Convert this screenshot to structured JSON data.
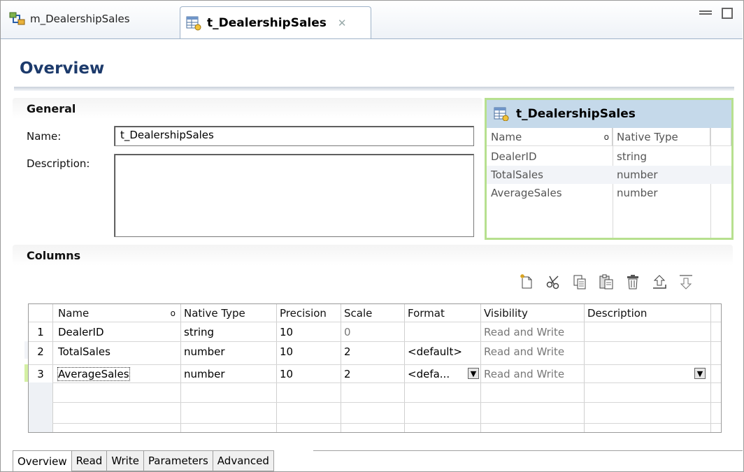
{
  "editor_tabs": [
    {
      "label": "m_DealershipSales",
      "active": false
    },
    {
      "label": "t_DealershipSales",
      "active": true,
      "closable": true
    }
  ],
  "overview": {
    "title": "Overview",
    "general": {
      "heading": "General",
      "name_label": "Name:",
      "name_value": "t_DealershipSales",
      "description_label": "Description:",
      "description_value": ""
    },
    "schema": {
      "title": "t_DealershipSales",
      "headers": [
        "Name",
        "Native Type"
      ],
      "rows": [
        {
          "name": "DealerID",
          "type": "string"
        },
        {
          "name": "TotalSales",
          "type": "number"
        },
        {
          "name": "AverageSales",
          "type": "number"
        }
      ]
    },
    "columns": {
      "heading": "Columns",
      "toolbar_icons": [
        "new-column-icon",
        "cut-icon",
        "copy-icon",
        "paste-icon",
        "delete-icon",
        "move-up-icon",
        "move-down-icon"
      ],
      "headers": [
        "Name",
        "Native Type",
        "Precision",
        "Scale",
        "Format",
        "Visibility",
        "Description"
      ],
      "rows": [
        {
          "num": "1",
          "name": "DealerID",
          "type": "string",
          "precision": "10",
          "scale": "0",
          "format": "",
          "visibility": "Read and Write",
          "description": ""
        },
        {
          "num": "2",
          "name": "TotalSales",
          "type": "number",
          "precision": "10",
          "scale": "2",
          "format": "<default>",
          "visibility": "Read and Write",
          "description": ""
        },
        {
          "num": "3",
          "name": "AverageSales",
          "type": "number",
          "precision": "10",
          "scale": "2",
          "format": "<defa...",
          "visibility": "Read and Write",
          "description": ""
        }
      ]
    }
  },
  "bottom_tabs": [
    "Overview",
    "Read",
    "Write",
    "Parameters",
    "Advanced"
  ],
  "colors": {
    "title_blue": "#1c3a6b",
    "selected_row": "#d4f0a4",
    "schema_border": "#b7e08f",
    "schema_header": "#c5d9ea"
  }
}
